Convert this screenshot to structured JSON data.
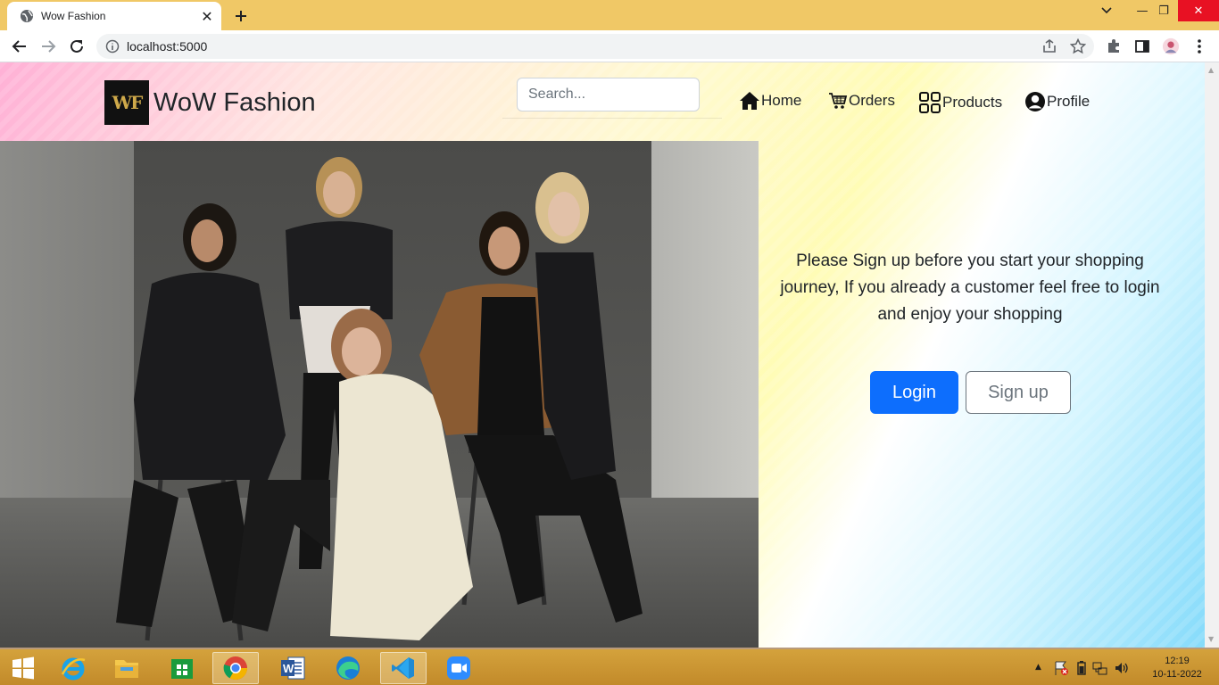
{
  "browser": {
    "tab_title": "Wow Fashion",
    "url": "localhost:5000",
    "minimize": "—",
    "restore": "❐",
    "close": "✕"
  },
  "site": {
    "brand_logo_text": "WF",
    "brand_name": "WoW Fashion",
    "search_placeholder": "Search...",
    "nav": [
      {
        "label": "Home",
        "icon": "house-icon"
      },
      {
        "label": "Orders",
        "icon": "cart-icon"
      },
      {
        "label": "Products",
        "icon": "grid-icon"
      },
      {
        "label": "Profile",
        "icon": "user-circle-icon"
      }
    ],
    "prompt_text": "Please Sign up before you start your shopping journey, If you already a customer feel free to login and enjoy your shopping",
    "login_label": "Login",
    "signup_label": "Sign up",
    "colors": {
      "primary": "#0d6efd",
      "secondary": "#6c757d"
    }
  },
  "taskbar": {
    "apps": [
      "start",
      "internet-explorer",
      "file-explorer",
      "store",
      "chrome",
      "word",
      "edge",
      "vscode",
      "zoom"
    ],
    "time": "12:19",
    "date": "10-11-2022"
  }
}
